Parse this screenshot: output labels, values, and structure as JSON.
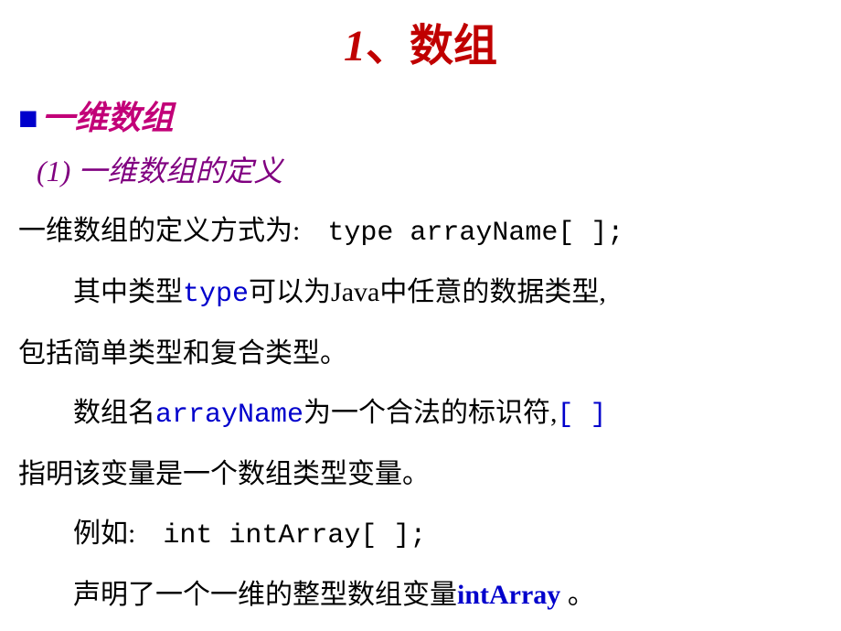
{
  "title": {
    "number": "1",
    "separator": "、",
    "text": "数组"
  },
  "section": {
    "bullet": "■",
    "title": "一维数组"
  },
  "subsection": {
    "number": "(1)",
    "title": "一维数组的定义"
  },
  "body": {
    "line1_a": "一维数组的定义方式为:　",
    "line1_code": "type arrayName[ ];",
    "line2_a": "其中类型",
    "line2_type": "type",
    "line2_b": "可以为Java中任意的数据类型,",
    "line3": "包括简单类型和复合类型。",
    "line4_a": "数组名",
    "line4_arrayname": "arrayName",
    "line4_b": "为一个合法的标识符,",
    "line4_bracket": "[ ]",
    "line5": "指明该变量是一个数组类型变量。",
    "line6_a": "例如:　",
    "line6_code": "int intArray[ ];",
    "line7_a": "声明了一个一维的整型数组变量",
    "line7_intarray": "intArray",
    "line7_b": " 。"
  }
}
